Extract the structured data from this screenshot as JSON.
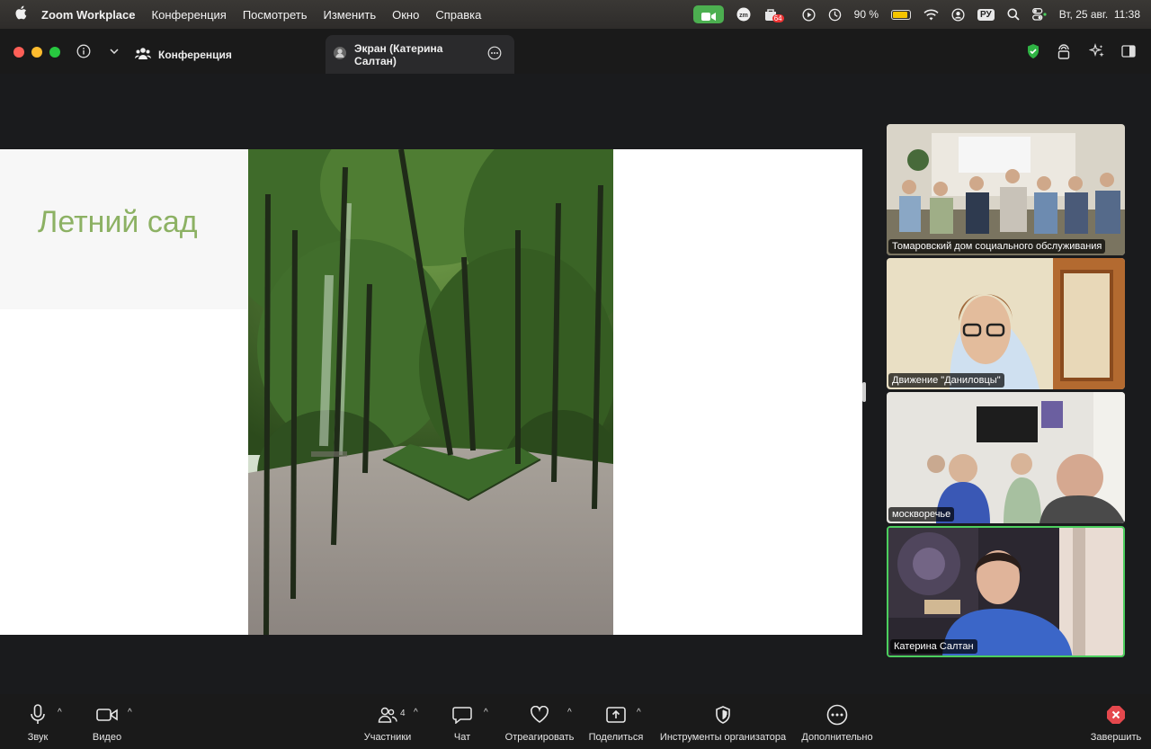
{
  "menubar": {
    "app_name": "Zoom Workplace",
    "menus": [
      "Конференция",
      "Посмотреть",
      "Изменить",
      "Окно",
      "Справка"
    ],
    "battery_percent": "90 %",
    "battery_level": 0.9,
    "input_language": "РУ",
    "notification_badge": "64",
    "datetime": "Вт, 25 авг.  11:38"
  },
  "titlebar": {
    "tabs": [
      {
        "label": "Конференция",
        "icon": "meeting-icon"
      },
      {
        "label": "Экран (Катерина Салтан)",
        "icon": "screen-share-icon"
      }
    ]
  },
  "slide": {
    "title": "Летний сад"
  },
  "gallery": {
    "participants": [
      {
        "name": "Томаровский дом социального обслуживания"
      },
      {
        "name": "Движение \"Даниловцы\""
      },
      {
        "name": "москворечье"
      },
      {
        "name": "Катерина Салтан",
        "active_speaker": true
      }
    ]
  },
  "toolbar": {
    "audio": "Звук",
    "video": "Видео",
    "participants": "Участники",
    "participants_count": "4",
    "chat": "Чат",
    "react": "Отреагировать",
    "share": "Поделиться",
    "host_tools": "Инструменты организатора",
    "more": "Дополнительно",
    "end": "Завершить"
  },
  "colors": {
    "accent_green": "#4ccf5e",
    "end_red": "#e5484d",
    "slide_title": "#8cb163"
  }
}
